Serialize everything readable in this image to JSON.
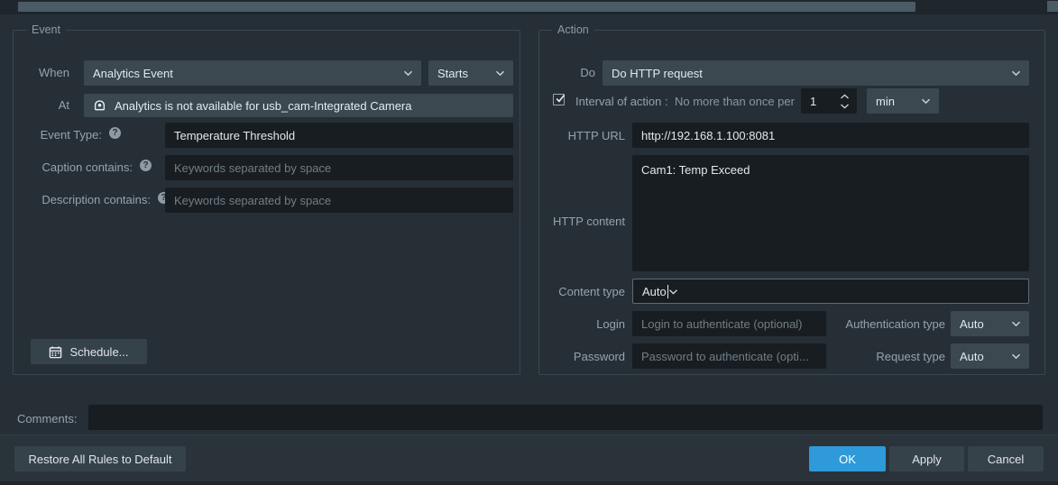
{
  "scrollbar": {
    "name": "horizontal-scrollbar"
  },
  "event_panel": {
    "title": "Event",
    "when_label": "When",
    "when_value": "Analytics Event",
    "when_state_value": "Starts",
    "at_label": "At",
    "at_icon": "camera-dome-icon",
    "at_value": "Analytics is not available for usb_cam-Integrated Camera",
    "event_type_label": "Event Type:",
    "event_type_value": "Temperature Threshold",
    "caption_label": "Caption contains:",
    "caption_placeholder": "Keywords separated by space",
    "description_label": "Description contains:",
    "description_placeholder": "Keywords separated by space",
    "help_glyph": "?",
    "schedule_button": "Schedule...",
    "schedule_icon": "calendar-icon"
  },
  "action_panel": {
    "title": "Action",
    "do_label": "Do",
    "do_value": "Do HTTP request",
    "interval_checked": true,
    "interval_label": "Interval of action :",
    "interval_sublabel": "No more than once per",
    "interval_value": "1",
    "interval_unit": "min",
    "http_url_label": "HTTP URL",
    "http_url_value": "http://192.168.1.100:8081",
    "http_content_label": "HTTP content",
    "http_content_value": "Cam1: Temp Exceed",
    "content_type_label": "Content type",
    "content_type_value": "Auto",
    "login_label": "Login",
    "login_placeholder": "Login to authenticate (optional)",
    "password_label": "Password",
    "password_placeholder": "Password to authenticate (opti...",
    "auth_type_label": "Authentication type",
    "auth_type_value": "Auto",
    "request_type_label": "Request type",
    "request_type_value": "Auto"
  },
  "comments": {
    "label": "Comments:",
    "value": ""
  },
  "footer": {
    "restore_label": "Restore All Rules to Default",
    "ok_label": "OK",
    "apply_label": "Apply",
    "cancel_label": "Cancel"
  },
  "colors": {
    "background": "#262f36",
    "panel_border": "#3a464e",
    "control_bg": "#3b4850",
    "input_bg": "#181d21",
    "accent": "#2e9ada",
    "label_text": "#96a3ac",
    "value_text": "#e3e8eb"
  }
}
